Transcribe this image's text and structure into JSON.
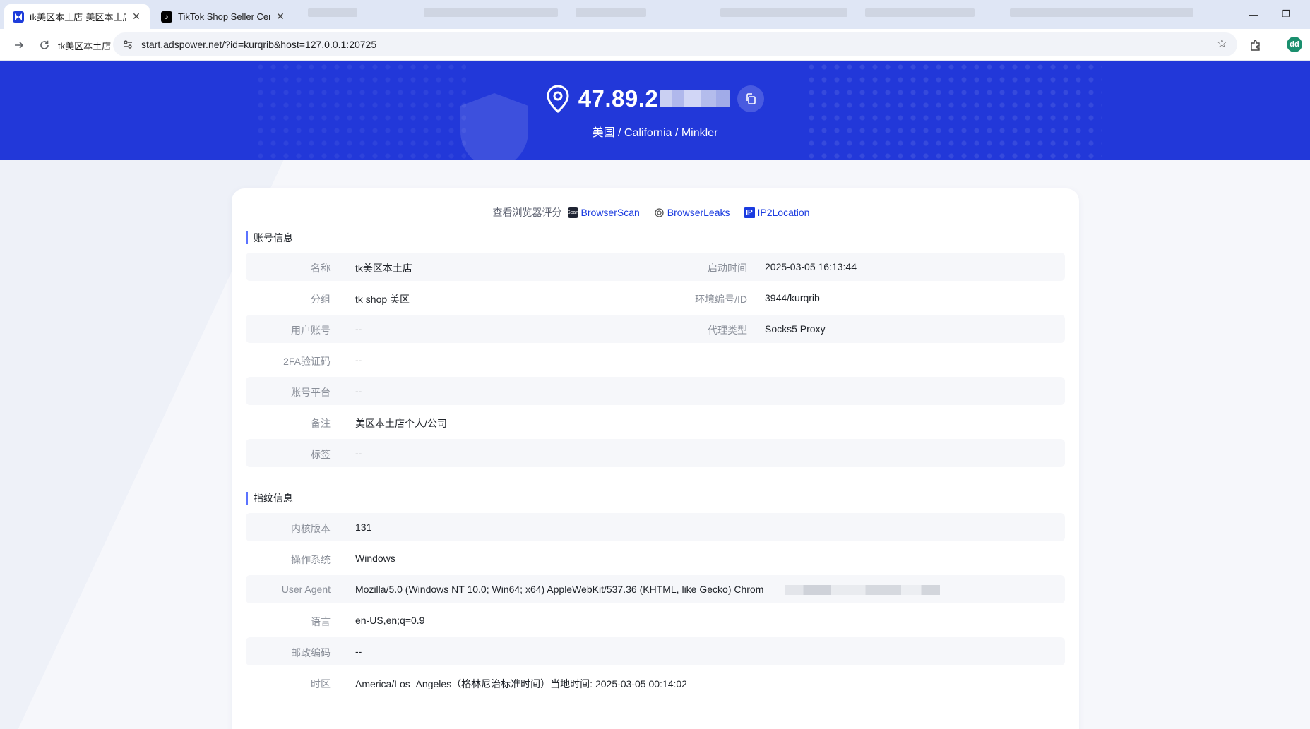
{
  "browser": {
    "tabs": [
      {
        "title": "tk美区本土店-美区本土店",
        "active": true
      },
      {
        "title": "TikTok Shop Seller Center",
        "active": false
      }
    ],
    "bookmark": "tk美区本土店",
    "url": "start.adspower.net/?id=kurqrib&host=127.0.0.1:20725",
    "profile_initials": "dd"
  },
  "hero": {
    "ip": "47.89.2",
    "location": "美国 / California / Minkler"
  },
  "checks": {
    "label": "查看浏览器评分",
    "links": [
      "BrowserScan",
      "BrowserLeaks",
      "IP2Location"
    ]
  },
  "account": {
    "title": "账号信息",
    "rows": [
      {
        "label": "名称",
        "value": "tk美区本土店",
        "label2": "启动时间",
        "value2": "2025-03-05 16:13:44"
      },
      {
        "label": "分组",
        "value": "tk shop 美区",
        "label2": "环境编号/ID",
        "value2": "3944/kurqrib"
      },
      {
        "label": "用户账号",
        "value": "--",
        "label2": "代理类型",
        "value2": "Socks5 Proxy"
      },
      {
        "label": "2FA验证码",
        "value": "--"
      },
      {
        "label": "账号平台",
        "value": "--"
      },
      {
        "label": "备注",
        "value": "美区本土店个人/公司"
      },
      {
        "label": "标签",
        "value": "--"
      }
    ]
  },
  "fingerprint": {
    "title": "指纹信息",
    "rows": [
      {
        "label": "内核版本",
        "value": "131"
      },
      {
        "label": "操作系统",
        "value": "Windows"
      },
      {
        "label": "User Agent",
        "value": "Mozilla/5.0 (Windows NT 10.0; Win64; x64) AppleWebKit/537.36 (KHTML, like Gecko) Chrom"
      },
      {
        "label": "语言",
        "value": "en-US,en;q=0.9"
      },
      {
        "label": "邮政编码",
        "value": "--"
      },
      {
        "label": "时区",
        "value": "America/Los_Angeles（格林尼治标准时间）当地时间: 2025-03-05 00:14:02"
      }
    ]
  },
  "colors": {
    "hero": "#2238d9",
    "accent": "#5b73ff",
    "link": "#1a3be0"
  }
}
